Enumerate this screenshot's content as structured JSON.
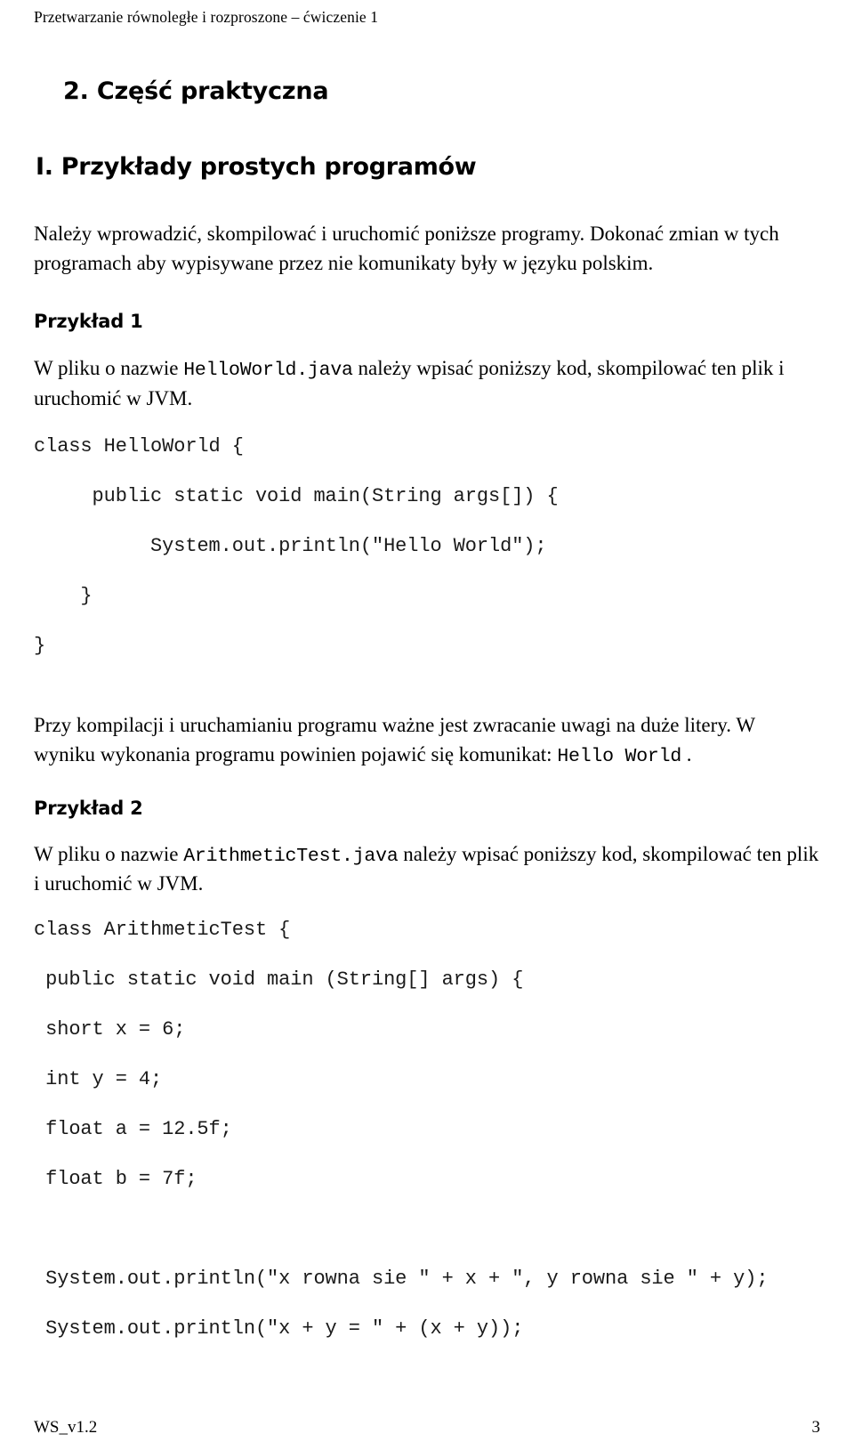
{
  "header": {
    "running_title": "Przetwarzanie równoległe i rozproszone – ćwiczenie 1"
  },
  "section": {
    "number_title": "2. Część praktyczna",
    "roman_title": "I. Przykłady prostych programów",
    "intro_paragraph": "Należy wprowadzić, skompilować i uruchomić poniższe programy. Dokonać zmian w tych programach aby wypisywane przez nie komunikaty były w języku polskim."
  },
  "example1": {
    "heading": "Przykład 1",
    "intro_before": "W pliku o nazwie ",
    "intro_mono": "HelloWorld.java",
    "intro_after": " należy wpisać poniższy kod, skompilować ten plik i uruchomić w JVM.",
    "code": [
      "class HelloWorld {",
      "",
      "     public static void main(String args[]) {",
      "",
      "          System.out.println(\"Hello World\");",
      "",
      "    }",
      "",
      "}"
    ],
    "note_before": "Przy kompilacji i uruchamianiu programu ważne jest zwracanie uwagi na duże litery. W wyniku wykonania programu powinien pojawić się komunikat: ",
    "note_mono": "Hello World",
    "note_after": " ."
  },
  "example2": {
    "heading": "Przykład 2",
    "intro_before": "W pliku o nazwie ",
    "intro_mono": "ArithmeticTest.java",
    "intro_after": " należy wpisać poniższy kod, skompilować ten plik i uruchomić w JVM.",
    "code": [
      "class ArithmeticTest {",
      "",
      " public static void main (String[] args) {",
      "",
      " short x = 6;",
      "",
      " int y = 4;",
      "",
      " float a = 12.5f;",
      "",
      " float b = 7f;",
      "",
      "",
      " System.out.println(\"x rowna sie \" + x + \", y rowna sie \" + y);",
      "",
      " System.out.println(\"x + y = \" + (x + y));"
    ]
  },
  "footer": {
    "version": "WS_v1.2",
    "page_number": "3"
  }
}
